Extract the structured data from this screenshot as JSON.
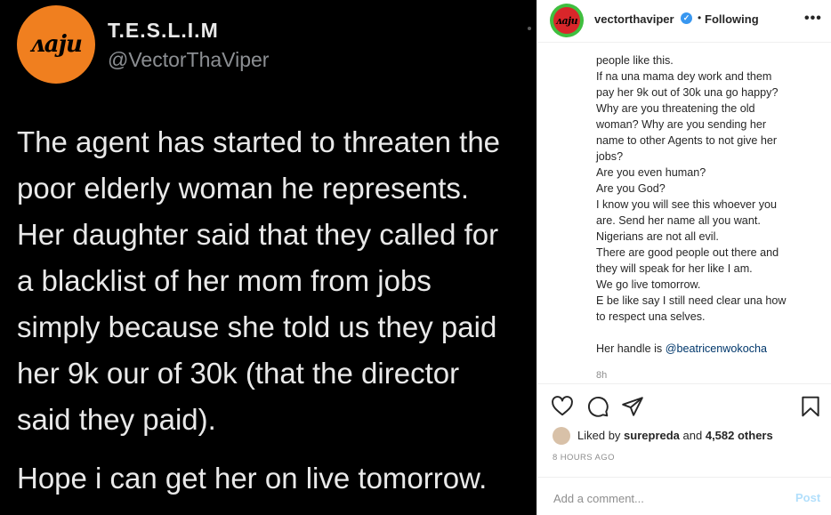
{
  "media": {
    "avatar_logo": "ᴧaju",
    "display_name": "T.E.S.L.I.M",
    "handle": "@VectorThaViper",
    "tweet_lines": [
      "The agent has started to threaten the",
      "poor elderly woman he represents.",
      "Her daughter said that they called for",
      "a blacklist of her mom from jobs",
      "simply because she told us they paid",
      "her 9k our of 30k (that the director",
      "said they paid)."
    ],
    "tweet_last": "Hope i can get her on live tomorrow."
  },
  "header": {
    "avatar_logo": "ᴧaju",
    "username": "vectorthaviper",
    "verified_glyph": "✓",
    "separator": "•",
    "follow_status": "Following",
    "more_glyph": "•••"
  },
  "caption": {
    "lines": [
      "people like this.",
      "If na una mama dey work and them",
      "pay her 9k out of 30k una go happy?",
      "Why are you threatening the old",
      "woman? Why are you sending her",
      "name to other Agents to not give her",
      "jobs?",
      "Are you even human?",
      "Are you God?",
      "I know you will see this whoever you",
      "are. Send her name all you want.",
      "Nigerians are not all evil.",
      "There are good people out there and",
      "they will speak for her like I am.",
      "We go live tomorrow.",
      "E be like say I still need clear una how",
      "to respect una selves."
    ],
    "handle_prefix": "Her handle is ",
    "handle_mention": "@beatricenwokocha",
    "age": "8h"
  },
  "actions": {
    "icons": [
      "heart-icon",
      "comment-icon",
      "share-icon",
      "bookmark-icon"
    ]
  },
  "likes": {
    "prefix": "Liked by ",
    "user": "surepreda",
    "middle": " and ",
    "others": "4,582 others"
  },
  "posted": "8 HOURS AGO",
  "comment": {
    "placeholder": "Add a comment...",
    "post_label": "Post"
  },
  "colors": {
    "media_bg": "#000000",
    "avatar_orange": "#f07f1f",
    "link_blue": "#00376b",
    "verified_blue": "#3897f0",
    "post_disabled": "#b2dffc"
  }
}
